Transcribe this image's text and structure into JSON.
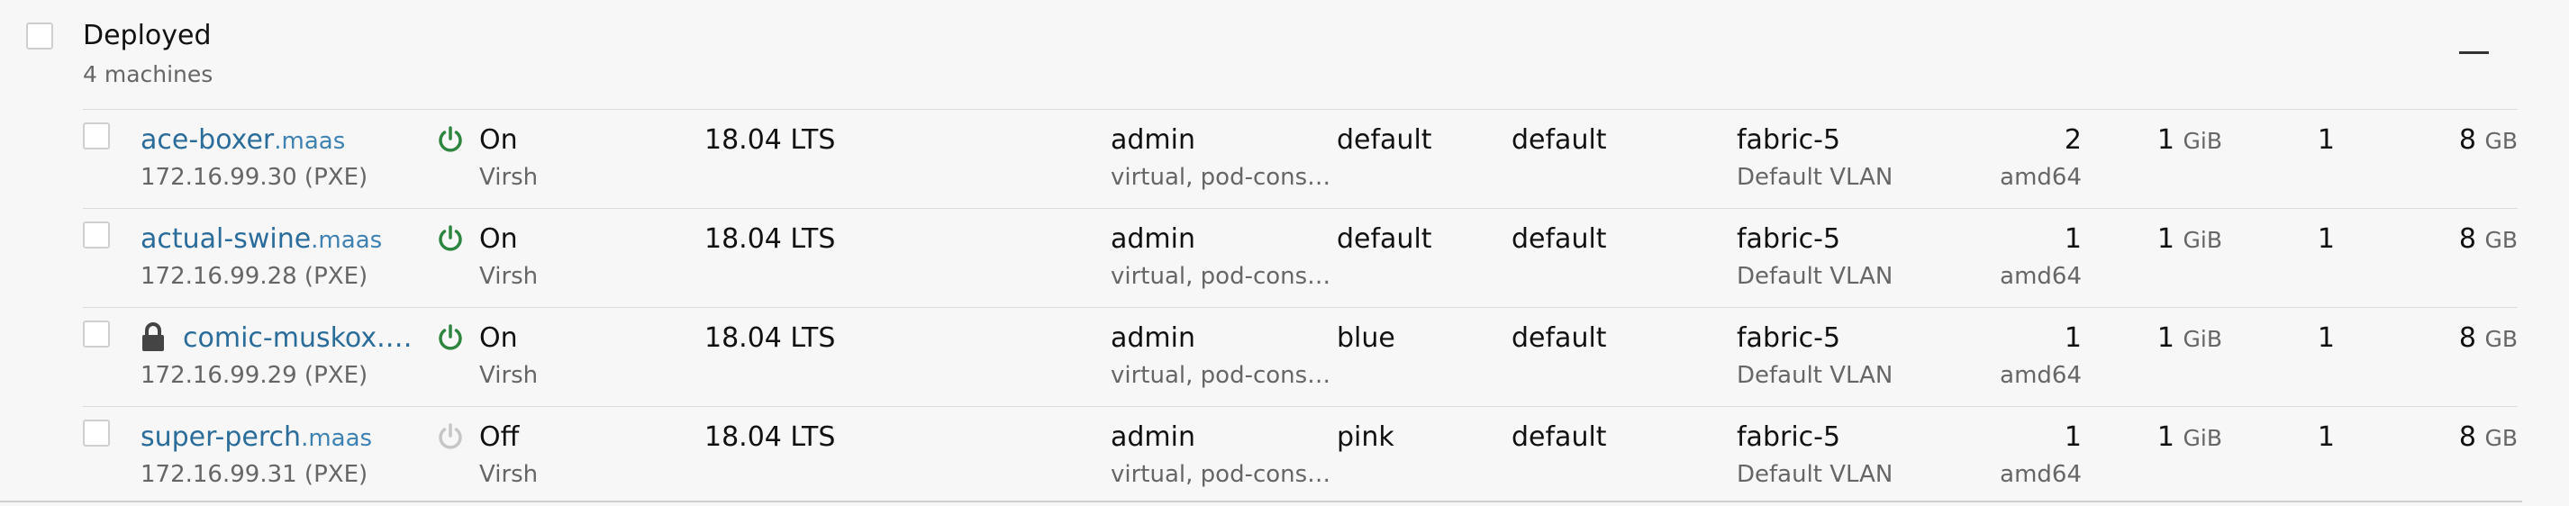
{
  "group": {
    "title": "Deployed",
    "subtitle": "4 machines"
  },
  "machines": [
    {
      "hostname": "ace-boxer",
      "domain": ".maas",
      "locked": false,
      "ip": "172.16.99.30 (PXE)",
      "power_state": "On",
      "power_type": "Virsh",
      "power_on": true,
      "os": "18.04 LTS",
      "owner": "admin",
      "tags": "virtual, pod-cons…",
      "pool": "default",
      "zone": "default",
      "fabric": "fabric-5",
      "vlan": "Default VLAN",
      "cores": "2",
      "arch": "amd64",
      "ram_value": "1",
      "ram_unit": "GiB",
      "disks": "1",
      "storage_value": "8",
      "storage_unit": "GB"
    },
    {
      "hostname": "actual-swine",
      "domain": ".maas",
      "locked": false,
      "ip": "172.16.99.28 (PXE)",
      "power_state": "On",
      "power_type": "Virsh",
      "power_on": true,
      "os": "18.04 LTS",
      "owner": "admin",
      "tags": "virtual, pod-cons…",
      "pool": "default",
      "zone": "default",
      "fabric": "fabric-5",
      "vlan": "Default VLAN",
      "cores": "1",
      "arch": "amd64",
      "ram_value": "1",
      "ram_unit": "GiB",
      "disks": "1",
      "storage_value": "8",
      "storage_unit": "GB"
    },
    {
      "hostname": "comic-muskox.…",
      "domain": "",
      "locked": true,
      "ip": "172.16.99.29 (PXE)",
      "power_state": "On",
      "power_type": "Virsh",
      "power_on": true,
      "os": "18.04 LTS",
      "owner": "admin",
      "tags": "virtual, pod-cons…",
      "pool": "blue",
      "zone": "default",
      "fabric": "fabric-5",
      "vlan": "Default VLAN",
      "cores": "1",
      "arch": "amd64",
      "ram_value": "1",
      "ram_unit": "GiB",
      "disks": "1",
      "storage_value": "8",
      "storage_unit": "GB"
    },
    {
      "hostname": "super-perch",
      "domain": ".maas",
      "locked": false,
      "ip": "172.16.99.31 (PXE)",
      "power_state": "Off",
      "power_type": "Virsh",
      "power_on": false,
      "os": "18.04 LTS",
      "owner": "admin",
      "tags": "virtual, pod-cons…",
      "pool": "pink",
      "zone": "default",
      "fabric": "fabric-5",
      "vlan": "Default VLAN",
      "cores": "1",
      "arch": "amd64",
      "ram_value": "1",
      "ram_unit": "GiB",
      "disks": "1",
      "storage_value": "8",
      "storage_unit": "GB"
    }
  ],
  "colors": {
    "power_on": "#2e8540",
    "power_off": "#c6c6c6",
    "link": "#2a6c9a"
  },
  "icons": {
    "power": "power-icon",
    "lock": "lock-icon",
    "collapse": "collapse-icon"
  }
}
